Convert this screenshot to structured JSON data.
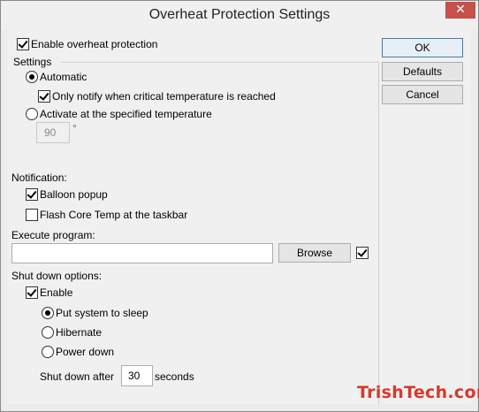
{
  "window": {
    "title": "Overheat Protection Settings",
    "close_glyph": "✕"
  },
  "enable_overheat": {
    "label": "Enable overheat protection",
    "checked": true
  },
  "settings": {
    "group_label": "Settings",
    "automatic_label": "Automatic",
    "only_notify_label": "Only notify when critical temperature is reached",
    "activate_label": "Activate at the specified temperature",
    "temperature_value": "90",
    "temperature_unit": "°"
  },
  "notification": {
    "label": "Notification:",
    "balloon_label": "Balloon popup",
    "flash_label": "Flash Core Temp at the taskbar"
  },
  "execute": {
    "label": "Execute program:",
    "value": "",
    "browse_label": "Browse"
  },
  "shutdown": {
    "label": "Shut down options:",
    "enable_label": "Enable",
    "sleep_label": "Put system to sleep",
    "hibernate_label": "Hibernate",
    "power_down_label": "Power down",
    "after_label": "Shut down after",
    "after_value": "30",
    "seconds_label": "seconds"
  },
  "buttons": {
    "ok": "OK",
    "defaults": "Defaults",
    "cancel": "Cancel"
  },
  "watermark": "TrishTech.com"
}
